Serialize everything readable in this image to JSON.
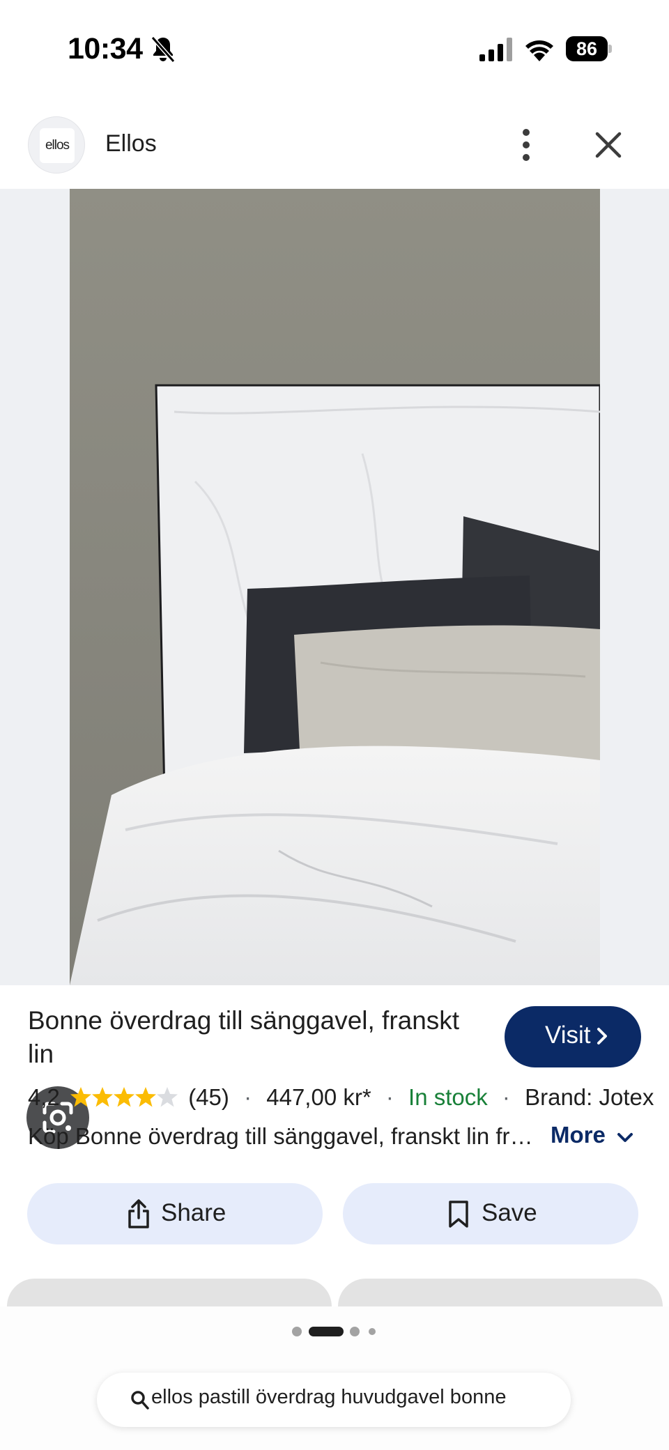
{
  "status_bar": {
    "time": "10:34",
    "battery": "86",
    "icons": [
      "bell-slash-icon",
      "cellular-signal-icon",
      "wifi-icon",
      "battery-icon"
    ]
  },
  "header": {
    "logo_text": "ellos",
    "site_name": "Ellos",
    "icons": [
      "more-vert-icon",
      "close-icon"
    ]
  },
  "product": {
    "title": "Bonne överdrag till sänggavel, franskt lin",
    "visit_label": "Visit",
    "rating": "4,2",
    "rating_value": 4.2,
    "rating_max": 5,
    "review_count": "(45)",
    "price": "447,00 kr*",
    "stock": "In stock",
    "brand": "Brand: Jotex",
    "description": "Köp Bonne överdrag till sänggavel, franskt lin från Jotex. Överdrag till sänggavel i franskt linne.",
    "more_label": "More",
    "separator": "·"
  },
  "actions": {
    "share_label": "Share",
    "save_label": "Save"
  },
  "pagination": {
    "total": 4,
    "active_index": 1
  },
  "search": {
    "query": "ellos pastill överdrag huvudgavel bonne"
  },
  "colors": {
    "visit_button": "#0b2a66",
    "in_stock": "#188038",
    "action_button_bg": "#e6ecfb",
    "star": "#fbbc04"
  }
}
